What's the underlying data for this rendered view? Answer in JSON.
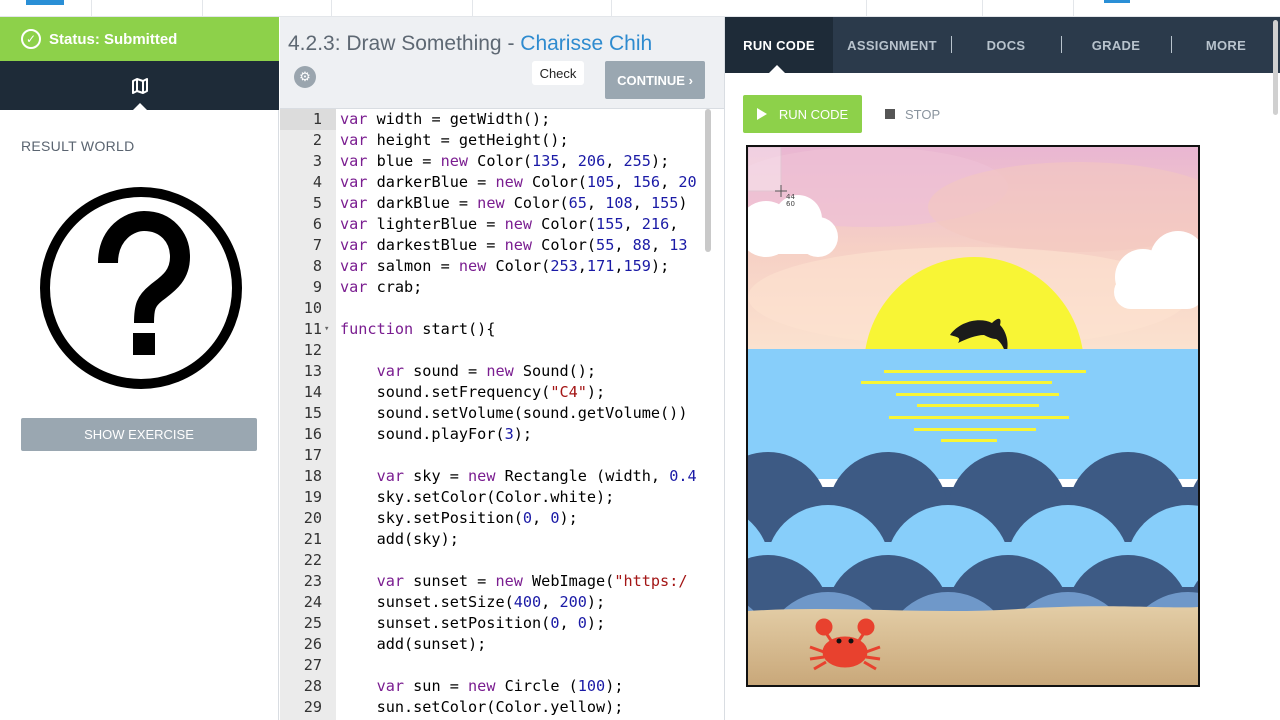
{
  "status": {
    "label": "Status: Submitted"
  },
  "left_panel": {
    "result_title": "RESULT WORLD",
    "show_exercise_label": "SHOW EXERCISE"
  },
  "exercise": {
    "number_title": "4.2.3: Draw Something",
    "separator": " - ",
    "author": "Charisse Chih",
    "check_label": "Check",
    "continue_label": "CONTINUE ›"
  },
  "code_lines": [
    "var width = getWidth();",
    "var height = getHeight();",
    "var blue = new Color(135, 206, 255);",
    "var darkerBlue = new Color(105, 156, 20",
    "var darkBlue = new Color(65, 108, 155)",
    "var lighterBlue = new Color(155, 216, ",
    "var darkestBlue = new Color(55, 88, 13",
    "var salmon = new Color(253,171,159);",
    "var crab;",
    "",
    "function start(){",
    "",
    "    var sound = new Sound();",
    "    sound.setFrequency(\"C4\");",
    "    sound.setVolume(sound.getVolume())",
    "    sound.playFor(3);",
    "",
    "    var sky = new Rectangle (width, 0.4",
    "    sky.setColor(Color.white);",
    "    sky.setPosition(0, 0);",
    "    add(sky);",
    "",
    "    var sunset = new WebImage(\"https:/",
    "    sunset.setSize(400, 200);",
    "    sunset.setPosition(0, 0);",
    "    add(sunset);",
    "",
    "    var sun = new Circle (100);",
    "    sun.setColor(Color.yellow);"
  ],
  "tabs": [
    {
      "label": "RUN CODE",
      "active": true
    },
    {
      "label": "ASSIGNMENT",
      "active": false
    },
    {
      "label": "DOCS",
      "active": false
    },
    {
      "label": "GRADE",
      "active": false
    },
    {
      "label": "MORE",
      "active": false
    }
  ],
  "run": {
    "run_label": "RUN CODE",
    "stop_label": "STOP"
  },
  "cursor_readout": {
    "x": "44",
    "y": "60"
  },
  "colors": {
    "status_green": "#8dd14a",
    "nav_dark": "#1e2b38",
    "tab_bar": "#2b3a4b",
    "author_blue": "#2e8bcf",
    "sun_yellow": "#f8f535",
    "water_blue": "#87cefa",
    "wave_dark": "#3d5a84",
    "sand": "#d9bf95",
    "crab_red": "#e8412e"
  }
}
